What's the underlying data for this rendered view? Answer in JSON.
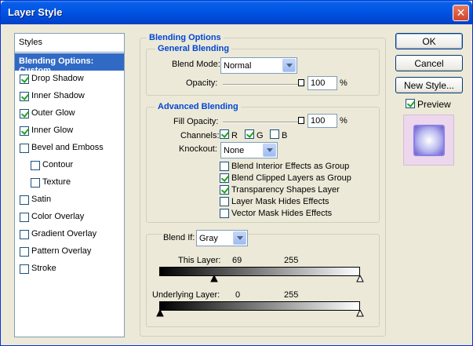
{
  "window": {
    "title": "Layer Style",
    "close_glyph": "✕"
  },
  "styles": {
    "header": "Styles",
    "selected": "Blending Options: Custom",
    "items": [
      {
        "label": "Drop Shadow",
        "checked": true
      },
      {
        "label": "Inner Shadow",
        "checked": true
      },
      {
        "label": "Outer Glow",
        "checked": true
      },
      {
        "label": "Inner Glow",
        "checked": true
      },
      {
        "label": "Bevel and Emboss",
        "checked": false
      },
      {
        "label": "Contour",
        "checked": false
      },
      {
        "label": "Texture",
        "checked": false
      },
      {
        "label": "Satin",
        "checked": false
      },
      {
        "label": "Color Overlay",
        "checked": false
      },
      {
        "label": "Gradient Overlay",
        "checked": false
      },
      {
        "label": "Pattern Overlay",
        "checked": false
      },
      {
        "label": "Stroke",
        "checked": false
      }
    ]
  },
  "blending": {
    "title": "Blending Options",
    "general": {
      "title": "General Blending",
      "blend_mode_label": "Blend Mode:",
      "blend_mode_value": "Normal",
      "opacity_label": "Opacity:",
      "opacity_value": "100",
      "percent": "%"
    },
    "advanced": {
      "title": "Advanced Blending",
      "fill_opacity_label": "Fill Opacity:",
      "fill_opacity_value": "100",
      "percent": "%",
      "channels_label": "Channels:",
      "channel_r": "R",
      "channel_g": "G",
      "channel_b": "B",
      "knockout_label": "Knockout:",
      "knockout_value": "None",
      "options": [
        {
          "label": "Blend Interior Effects as Group",
          "checked": false
        },
        {
          "label": "Blend Clipped Layers as Group",
          "checked": true
        },
        {
          "label": "Transparency Shapes Layer",
          "checked": true
        },
        {
          "label": "Layer Mask Hides Effects",
          "checked": false
        },
        {
          "label": "Vector Mask Hides Effects",
          "checked": false
        }
      ]
    },
    "blend_if": {
      "label": "Blend If:",
      "value": "Gray",
      "this_layer_label": "This Layer:",
      "this_layer_low": "69",
      "this_layer_high": "255",
      "underlying_label": "Underlying Layer:",
      "underlying_low": "0",
      "underlying_high": "255"
    }
  },
  "buttons": {
    "ok": "OK",
    "cancel": "Cancel",
    "new_style": "New Style...",
    "preview_label": "Preview"
  }
}
